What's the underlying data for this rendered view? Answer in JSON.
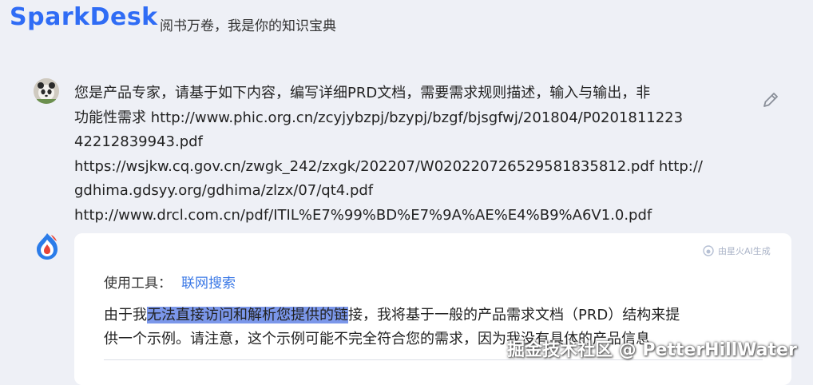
{
  "header": {
    "logo": "SparkDesk",
    "slogan": "阅书万卷，我是你的知识宝典"
  },
  "user_message": {
    "lines": [
      "您是产品专家，请基于如下内容，编写详细PRD文档，需要需求规则描述，输入与输出，非",
      "功能性需求 http://www.phic.org.cn/zcyjybzpj/bzypj/bzgf/bjsgfwj/201804/P0201811223",
      "42212839943.pdf",
      "https://wsjkw.cq.gov.cn/zwgk_242/zxgk/202207/W020220726529581835812.pdf http://",
      "gdhima.gdsyy.org/gdhima/zlzx/07/qt4.pdf",
      "http://www.drcl.com.cn/pdf/ITIL%E7%99%BD%E7%9A%AE%E4%B9%A6V1.0.pdf"
    ]
  },
  "bot_message": {
    "ai_badge": "由星火AI生成",
    "tool_label": "使用工具：",
    "tool_name": "联网搜索",
    "line1_before": "由于我",
    "line1_highlight": "无法直接访问和解析您提供的链",
    "line1_after": "接，我将基于一般的产品需求文档（PRD）结构来提",
    "line2": "供一个示例。请注意，这个示例可能不完全符合您的需求，因为我没有具体的产品信息"
  },
  "watermark": "掘金技术社区 @ PetterHillWater",
  "icons": {
    "edit": "pencil-icon",
    "bot_avatar": "spark-logo-icon",
    "user_avatar": "panda-avatar"
  },
  "colors": {
    "brand": "#2f6cf5",
    "link": "#3a78e6",
    "highlight": "#7b97ea",
    "background": "#eef0f6"
  }
}
